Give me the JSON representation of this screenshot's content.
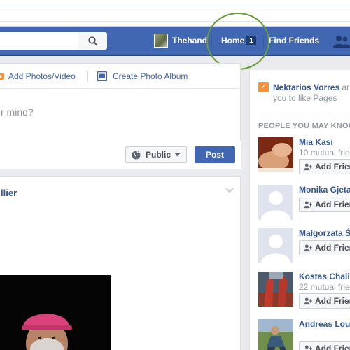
{
  "topbar": {
    "profile_name": "Thehand",
    "home_label": "Home",
    "home_count": "1",
    "find_friends_label": "Find Friends"
  },
  "composer": {
    "add_photos_label": "Add Photos/Video",
    "create_album_label": "Create Photo Album",
    "placeholder": "r mind?",
    "privacy_label": "Public",
    "post_label": "Post"
  },
  "story": {
    "author_partial": "llier"
  },
  "right": {
    "invite_name": "Nektarios Vorres",
    "invite_rest_1": " ar",
    "invite_rest_2": "you to like Pages",
    "pymk_header": "PEOPLE YOU MAY KNOW",
    "add_label": "Add Frien",
    "people": [
      {
        "name": "Mia Kasi",
        "mutual": "10 mutual frien"
      },
      {
        "name": "Monika Gjeta",
        "mutual": ""
      },
      {
        "name": "Małgorzata Ś",
        "mutual": ""
      },
      {
        "name": "Kostas Chali",
        "mutual": "22 mutual frien"
      },
      {
        "name": "Andreas Lou",
        "mutual": ""
      }
    ]
  },
  "colors": {
    "brand_blue": "#4267b2",
    "link_blue": "#365899",
    "annotation_green": "#6a9a3c"
  },
  "icons": [
    "search-icon",
    "camera-icon",
    "album-icon",
    "globe-icon",
    "caret-down-icon",
    "friends-icon",
    "chevron-down-icon",
    "pages-icon",
    "add-friend-icon"
  ]
}
